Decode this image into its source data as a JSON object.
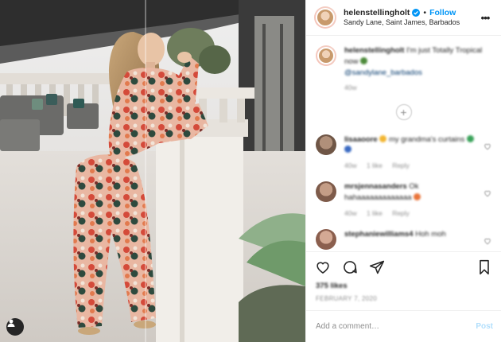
{
  "header": {
    "username": "helenstellingholt",
    "separator": "•",
    "follow_label": "Follow",
    "location": "Sandy Lane, Saint James, Barbados",
    "more_icon": "more-horizontal-icon"
  },
  "caption": {
    "username": "helenstellingholt",
    "text": "I'm just Totally Tropical now",
    "mention": "@sandylane_barbados",
    "age": "40w"
  },
  "comments": [
    {
      "username": "lisaaoore",
      "text": "my grandma's curtains",
      "age": "40w",
      "likes": "1 like",
      "reply_label": "Reply"
    },
    {
      "username": "mrsjennasanders",
      "text": "Ok hahaaaaaaaaaaaaa",
      "age": "40w",
      "likes": "1 like",
      "reply_label": "Reply"
    },
    {
      "username": "stephaniewilliams4",
      "text": "Hoh moh"
    }
  ],
  "actions": {
    "like_icon": "heart-icon",
    "comment_icon": "comment-bubble-icon",
    "share_icon": "paper-plane-icon",
    "save_icon": "bookmark-icon"
  },
  "likes_count": "375 likes",
  "date": "FEBRUARY 7, 2020",
  "add_comment": {
    "placeholder": "Add a comment…",
    "post_label": "Post"
  },
  "colors": {
    "accent_blue": "#0095f6",
    "post_disabled": "#b2dffc",
    "text": "#262626",
    "muted": "#8e8e8e"
  }
}
